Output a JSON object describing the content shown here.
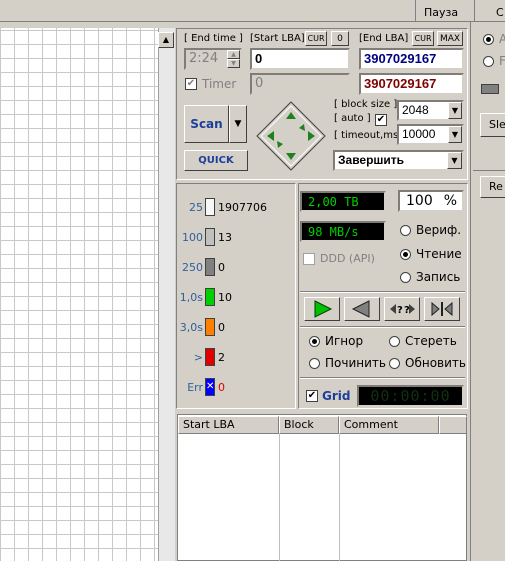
{
  "topbar": {
    "pause_label": "Пауза",
    "stop_label": "С"
  },
  "controls": {
    "end_time_label": "[ End time ]",
    "end_time_value": "2:24",
    "start_lba_label": "[Start LBA]",
    "cur_label": "CUR",
    "zero_label": "0",
    "end_lba_label": "[End LBA]",
    "max_label": "MAX",
    "start_lba_value": "0",
    "end_lba_value": "3907029167",
    "timer_label": "Timer",
    "timer_value": "0",
    "end_lba_value2": "3907029167",
    "scan_label": "Scan",
    "quick_label": "QUICK",
    "block_size_label": "[ block size ]",
    "auto_label": "[ auto ]",
    "block_size_value": "2048",
    "timeout_label": "[ timeout,ms ]",
    "timeout_value": "10000",
    "action_value": "Завершить"
  },
  "legend": [
    {
      "label": "25",
      "count": "1907706",
      "color": "#f8f8f8"
    },
    {
      "label": "100",
      "count": "13",
      "color": "#c0c0c0"
    },
    {
      "label": "250",
      "count": "0",
      "color": "#808080"
    },
    {
      "label": "1,0s",
      "count": "10",
      "color": "#00d000"
    },
    {
      "label": "3,0s",
      "count": "0",
      "color": "#ff8000"
    },
    {
      "label": ">",
      "count": "2",
      "color": "#e00000"
    },
    {
      "label": "Err",
      "count": "0",
      "color": "#0000ff"
    }
  ],
  "status": {
    "capacity": "2,00 TB",
    "percent": "100",
    "percent_unit": "%",
    "speed": "98 MB/s",
    "ddd_label": "DDD (API)",
    "verify_label": "Вериф.",
    "read_label": "Чтение",
    "write_label": "Запись"
  },
  "modes": {
    "ignore_label": "Игнор",
    "erase_label": "Стереть",
    "repair_label": "Починить",
    "refresh_label": "Обновить"
  },
  "grid_toggle": {
    "label": "Grid",
    "timer": "00:00:00"
  },
  "table": {
    "columns": [
      "Start LBA",
      "Block",
      "Comment"
    ]
  },
  "right_panel": {
    "opt1": "A",
    "opt2": "F",
    "btn1": "Sle",
    "btn2": "Re"
  },
  "colors": {
    "accent": "#00d000",
    "lba_blue": "#000080",
    "lba_red": "#800000"
  }
}
